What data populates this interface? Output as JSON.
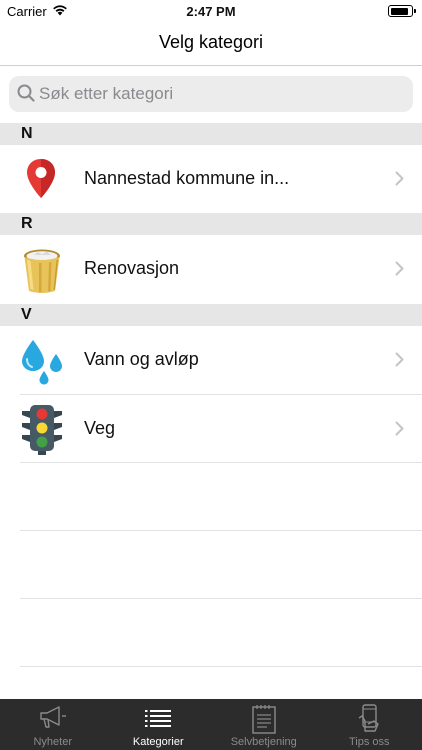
{
  "status_bar": {
    "carrier": "Carrier",
    "time": "2:47 PM"
  },
  "nav": {
    "title": "Velg kategori"
  },
  "search": {
    "placeholder": "Søk etter kategori"
  },
  "sections": [
    {
      "letter": "N",
      "items": [
        {
          "label": "Nannestad kommune in...",
          "icon": "map-pin-icon"
        }
      ]
    },
    {
      "letter": "R",
      "items": [
        {
          "label": "Renovasjon",
          "icon": "trash-bin-icon"
        }
      ]
    },
    {
      "letter": "V",
      "items": [
        {
          "label": "Vann og avløp",
          "icon": "water-drops-icon"
        },
        {
          "label": "Veg",
          "icon": "traffic-light-icon"
        }
      ]
    }
  ],
  "tabs": [
    {
      "label": "Nyheter",
      "icon": "megaphone-icon",
      "active": false
    },
    {
      "label": "Kategorier",
      "icon": "list-icon",
      "active": true
    },
    {
      "label": "Selvbetjening",
      "icon": "notepad-icon",
      "active": false
    },
    {
      "label": "Tips oss",
      "icon": "phone-hand-icon",
      "active": false
    }
  ],
  "colors": {
    "tabbar_bg": "#2c2c2c",
    "section_bg": "#e6e6e6",
    "pin_red": "#e53935"
  }
}
